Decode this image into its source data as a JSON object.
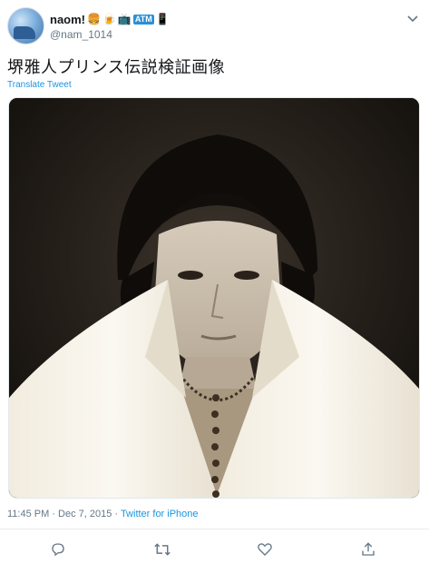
{
  "user": {
    "display_name": "naom!",
    "handle": "@nam_1014",
    "emojis": [
      "🍔",
      "🍺",
      "📺",
      "ATM",
      "📱"
    ]
  },
  "tweet": {
    "text": "堺雅人プリンス伝説検証画像",
    "translate_label": "Translate Tweet"
  },
  "meta": {
    "time": "11:45 PM · Dec 7, 2015 · ",
    "source": "Twitter for iPhone"
  },
  "icons": {
    "reply": "reply-icon",
    "retweet": "retweet-icon",
    "like": "like-icon",
    "share": "share-icon",
    "more": "chevron-down-icon"
  },
  "colors": {
    "accent": "#1b95e0",
    "muted": "#657786",
    "text": "#14171a"
  }
}
